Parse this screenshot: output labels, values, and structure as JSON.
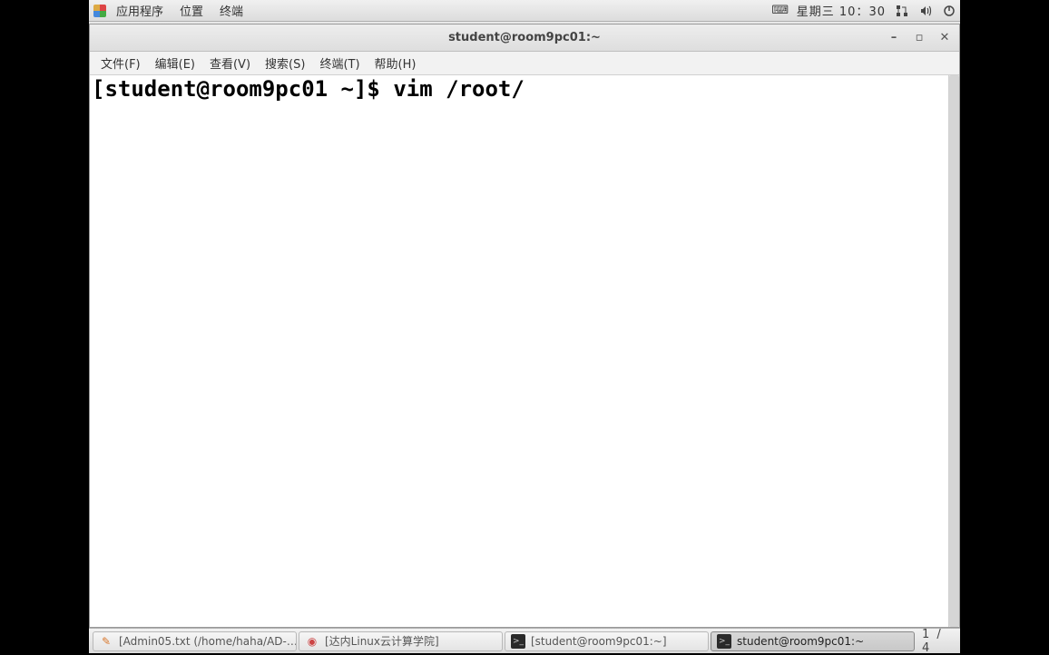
{
  "top_panel": {
    "applications": "应用程序",
    "places": "位置",
    "terminal": "终端",
    "datetime": "星期三 10：30"
  },
  "window": {
    "title": "student@room9pc01:~",
    "menu": {
      "file": "文件(F)",
      "edit": "编辑(E)",
      "view": "查看(V)",
      "search": "搜索(S)",
      "terminal": "终端(T)",
      "help": "帮助(H)"
    },
    "terminal_line": "[student@room9pc01 ~]$ vim /root/"
  },
  "taskbar": {
    "items": [
      {
        "label": "[Admin05.txt (/home/haha/AD-…",
        "icon": "editor"
      },
      {
        "label": "[达内Linux云计算学院]",
        "icon": "browser"
      },
      {
        "label": "[student@room9pc01:~]",
        "icon": "term"
      },
      {
        "label": "student@room9pc01:~",
        "icon": "term"
      }
    ],
    "workspace": "1 / 4"
  }
}
